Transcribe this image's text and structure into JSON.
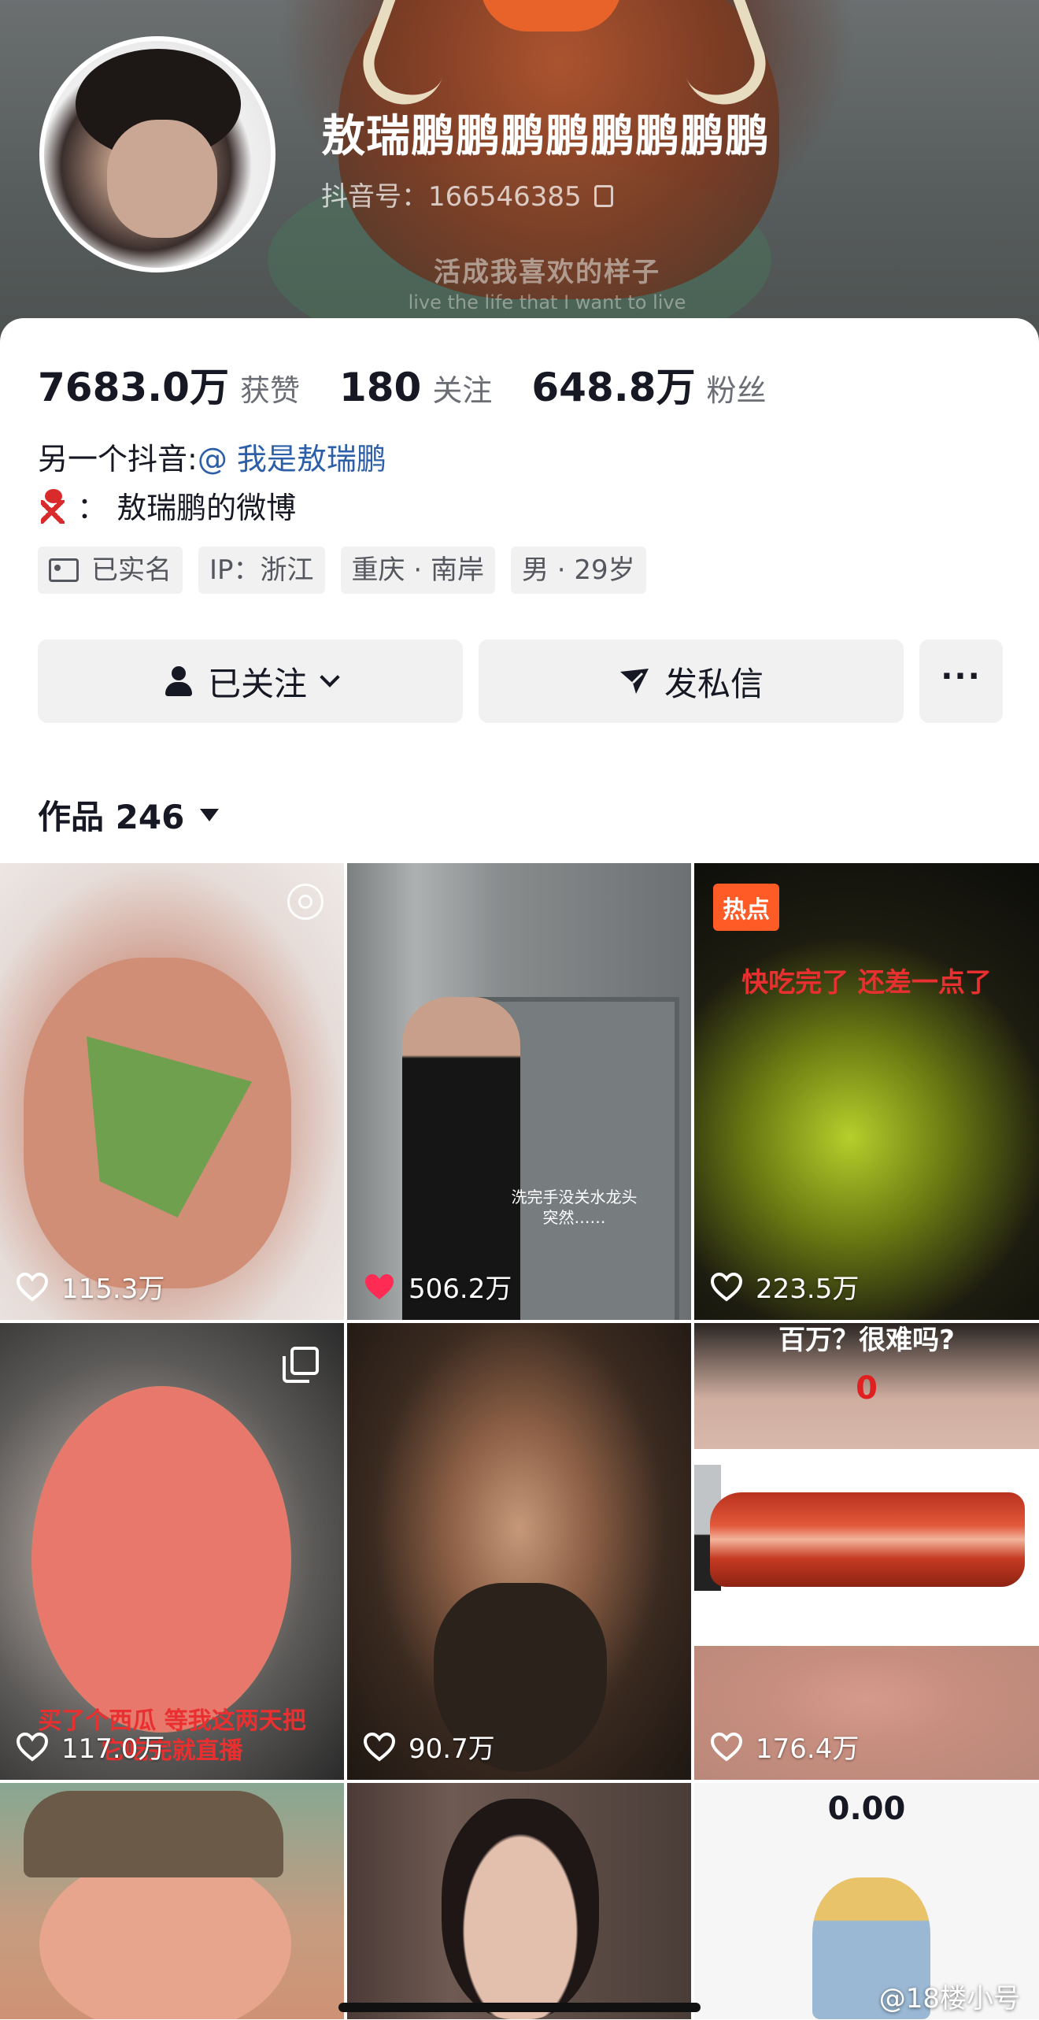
{
  "profile": {
    "nickname": "敖瑞鹏鹏鹏鹏鹏鹏鹏鹏",
    "douyin_id": "抖音号：166546385",
    "banner_slogan_cn": "活成我喜欢的样子",
    "banner_slogan_en": "live the life that I want to live"
  },
  "stats": [
    {
      "value": "7683.0万",
      "label": "获赞"
    },
    {
      "value": "180",
      "label": "关注"
    },
    {
      "value": "648.8万",
      "label": "粉丝"
    }
  ],
  "bio": {
    "line1_prefix": "另一个抖音:",
    "line1_mention": "@ 我是敖瑞鹏",
    "line2": "：  敖瑞鹏的微博"
  },
  "tags": [
    "已实名",
    "IP：浙江",
    "重庆 · 南岸",
    "男 · 29岁"
  ],
  "actions": {
    "follow_label": "已关注",
    "message_label": "发私信",
    "more_label": "···"
  },
  "works": {
    "label": "作品 246"
  },
  "grid": [
    {
      "likes": "115.3万",
      "liked": false
    },
    {
      "likes": "506.2万",
      "liked": true,
      "caption_line1": "洗完手没关水龙头",
      "caption_line2": "突然……"
    },
    {
      "likes": "223.5万",
      "liked": false,
      "badge": "热点",
      "overlay": "快吃完了  还差一点了"
    },
    {
      "likes": "117.0万",
      "liked": false,
      "overlay_line1": "买了个西瓜 等我这两天把",
      "overlay_line2": "它吃完就直播"
    },
    {
      "likes": "90.7万",
      "liked": false
    },
    {
      "likes": "176.4万",
      "liked": false,
      "top_text": "百万？很难吗?",
      "counter": "0"
    },
    {},
    {},
    {
      "top_number": "0.00"
    }
  ],
  "watermark": "@18楼小号",
  "colors": {
    "liked_heart": "#fe2c55",
    "hot_badge": "#fe5b26",
    "mention": "#2d5fa8"
  }
}
